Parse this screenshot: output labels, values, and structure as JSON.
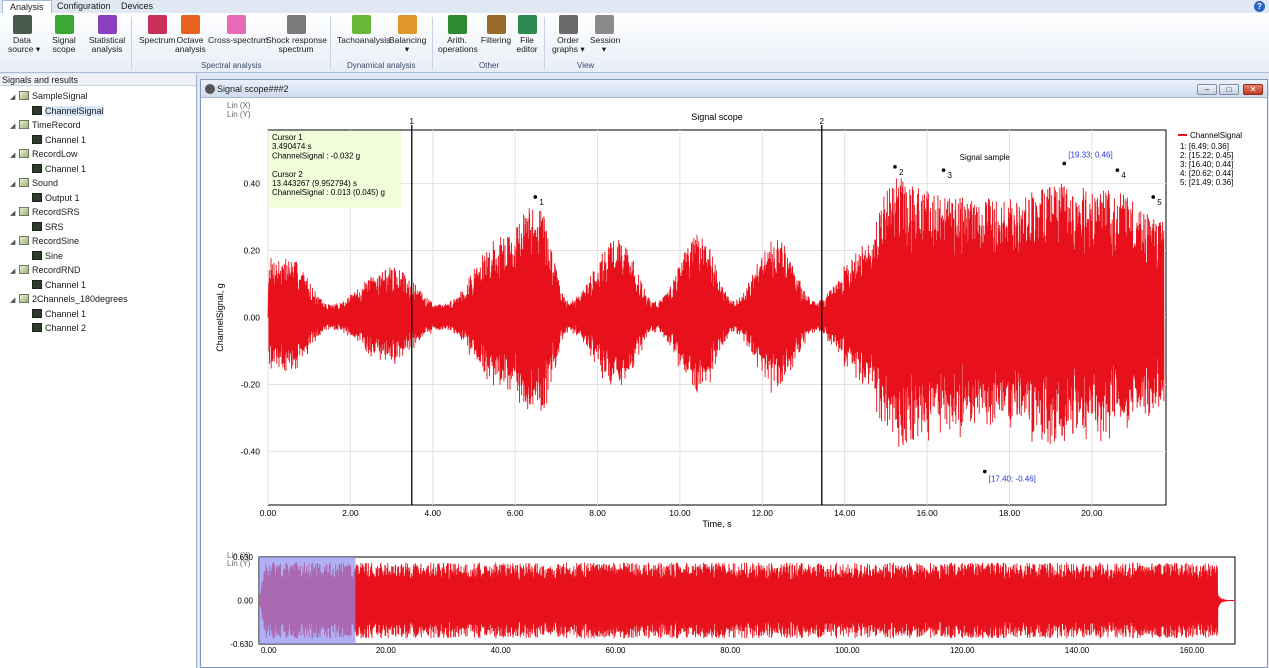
{
  "tabs": [
    {
      "label": "Analysis",
      "active": true
    },
    {
      "label": "Configuration",
      "active": false
    },
    {
      "label": "Devices",
      "active": false
    }
  ],
  "help_glyph": "?",
  "ribbon": {
    "buttons": [
      {
        "id": "data-source",
        "label1": "Data",
        "label2": "source ▾",
        "icon": "database-icon",
        "color": "#4a5a4a"
      },
      {
        "id": "signal-scope",
        "label1": "Signal",
        "label2": "scope",
        "icon": "oscilloscope-icon",
        "color": "#3aa832"
      },
      {
        "id": "statistical-analysis",
        "label1": "Statistical",
        "label2": "analysis",
        "icon": "statistics-icon",
        "color": "#8a3ec0"
      },
      {
        "id": "spectrum",
        "label1": "Spectrum",
        "label2": "",
        "icon": "spectrum-icon",
        "color": "#c8305a"
      },
      {
        "id": "octave-analysis",
        "label1": "Octave",
        "label2": "analysis",
        "icon": "octave-icon",
        "color": "#e8641e"
      },
      {
        "id": "cross-spectrum",
        "label1": "Cross-spectrum",
        "label2": "",
        "icon": "cross-spectrum-icon",
        "color": "#e86ab4"
      },
      {
        "id": "shock-response-spectrum",
        "label1": "Shock response",
        "label2": "spectrum",
        "icon": "shock-icon",
        "color": "#7a7a7a"
      },
      {
        "id": "tachoanalysis",
        "label1": "Tachoanalysis",
        "label2": "",
        "icon": "tacho-icon",
        "color": "#6ab83a"
      },
      {
        "id": "balancing",
        "label1": "Balancing",
        "label2": "▾",
        "icon": "balancing-icon",
        "color": "#e0962a"
      },
      {
        "id": "arith-operations",
        "label1": "Arith.",
        "label2": "operations",
        "icon": "plus-icon",
        "color": "#2e8a2e"
      },
      {
        "id": "filtering",
        "label1": "Filtering",
        "label2": "",
        "icon": "filter-icon",
        "color": "#9a6a2a"
      },
      {
        "id": "file-editor",
        "label1": "File",
        "label2": "editor",
        "icon": "pencil-icon",
        "color": "#2e8a4e"
      },
      {
        "id": "order-graphs",
        "label1": "Order",
        "label2": "graphs ▾",
        "icon": "order-graphs-icon",
        "color": "#6a6a6a"
      },
      {
        "id": "session",
        "label1": "Session",
        "label2": "▾",
        "icon": "session-icon",
        "color": "#8a8a8a"
      }
    ],
    "groups": {
      "spectral": "Spectral analysis",
      "dynamical": "Dynamical analysis",
      "other": "Other",
      "view": "View"
    }
  },
  "panel": {
    "title": "Signals and results",
    "items": [
      {
        "label": "SampleSignal",
        "level": 0
      },
      {
        "label": "ChannelSignal",
        "level": 1,
        "selected": true
      },
      {
        "label": "TimeRecord",
        "level": 0
      },
      {
        "label": "Channel 1",
        "level": 1
      },
      {
        "label": "RecordLow",
        "level": 0
      },
      {
        "label": "Channel 1",
        "level": 1
      },
      {
        "label": "Sound",
        "level": 0
      },
      {
        "label": "Output 1",
        "level": 1
      },
      {
        "label": "RecordSRS",
        "level": 0
      },
      {
        "label": "SRS",
        "level": 1
      },
      {
        "label": "RecordSine",
        "level": 0
      },
      {
        "label": "Sine",
        "level": 1
      },
      {
        "label": "RecordRND",
        "level": 0
      },
      {
        "label": "Channel 1",
        "level": 1
      },
      {
        "label": "2Channels_180degrees",
        "level": 0
      },
      {
        "label": "Channel 1",
        "level": 1
      },
      {
        "label": "Channel 2",
        "level": 1
      }
    ]
  },
  "window": {
    "title": "Signal scope###2",
    "min": "–",
    "max": "□",
    "close": "✕"
  },
  "scale_labels": {
    "x": "Lin (X)",
    "y": "Lin (Y)"
  },
  "chart_data": [
    {
      "type": "line",
      "title": "Signal scope",
      "xlabel": "Time, s",
      "ylabel": "ChannelSignal, g",
      "xlim": [
        0,
        21.8
      ],
      "ylim": [
        -0.56,
        0.56
      ],
      "x_ticks": [
        "0.00",
        "2.00",
        "4.00",
        "6.00",
        "8.00",
        "10.00",
        "12.00",
        "14.00",
        "16.00",
        "18.00",
        "20.00"
      ],
      "y_ticks": [
        "0.40",
        "0.20",
        "0.00",
        "-0.20",
        "-0.40"
      ],
      "series": [
        {
          "name": "ChannelSignal",
          "color": "#e8101a"
        }
      ],
      "envelope": [
        {
          "x": 0.5,
          "a": 0.18
        },
        {
          "x": 1.5,
          "a": 0.04
        },
        {
          "x": 3.0,
          "a": 0.15
        },
        {
          "x": 4.2,
          "a": 0.04
        },
        {
          "x": 5.8,
          "a": 0.25
        },
        {
          "x": 6.5,
          "a": 0.35
        },
        {
          "x": 7.3,
          "a": 0.05
        },
        {
          "x": 8.5,
          "a": 0.24
        },
        {
          "x": 9.4,
          "a": 0.05
        },
        {
          "x": 10.5,
          "a": 0.25
        },
        {
          "x": 11.3,
          "a": 0.05
        },
        {
          "x": 12.3,
          "a": 0.24
        },
        {
          "x": 13.3,
          "a": 0.05
        },
        {
          "x": 14.5,
          "a": 0.22
        },
        {
          "x": 15.2,
          "a": 0.42
        },
        {
          "x": 16.0,
          "a": 0.38
        },
        {
          "x": 17.0,
          "a": 0.36
        },
        {
          "x": 18.0,
          "a": 0.36
        },
        {
          "x": 19.3,
          "a": 0.4
        },
        {
          "x": 20.5,
          "a": 0.38
        },
        {
          "x": 21.6,
          "a": 0.3
        }
      ],
      "cursors": [
        {
          "label": "1",
          "x": 3.490474
        },
        {
          "label": "2",
          "x": 13.443267
        }
      ],
      "cursor_box": [
        "Cursor 1",
        "3.490474 s",
        "ChannelSignal : -0.032 g",
        "",
        "Cursor 2",
        "13.443267 (9.952794) s",
        "ChannelSignal : 0.013 (0.045) g"
      ],
      "peaks": [
        {
          "label": "1",
          "x": 6.49,
          "y": 0.36
        },
        {
          "label": "2",
          "x": 15.22,
          "y": 0.45
        },
        {
          "label": "3",
          "x": 16.4,
          "y": 0.44
        },
        {
          "label": "4",
          "x": 20.62,
          "y": 0.44
        },
        {
          "label": "5",
          "x": 21.49,
          "y": 0.36
        }
      ],
      "annotations": [
        {
          "text": "[19.33; 0.46]",
          "x": 19.33,
          "y": 0.46
        },
        {
          "text": "[17.40; -0.46]",
          "x": 17.4,
          "y": -0.46
        }
      ],
      "sample_label": "Signal sample",
      "legend_title": "ChannelSignal",
      "legend_entries": [
        "1: [6.49; 0.36]",
        "2: [15.22; 0.45]",
        "3: [16.40; 0.44]",
        "4: [20.62; 0.44]",
        "5: [21.49; 0.36]"
      ],
      "legend_position": "right"
    },
    {
      "type": "area",
      "xlim": [
        0,
        170
      ],
      "ylim": [
        -0.63,
        0.63
      ],
      "x_ticks": [
        "0.00",
        "20.00",
        "40.00",
        "60.00",
        "80.00",
        "100.00",
        "120.00",
        "140.00",
        "160.00"
      ],
      "y_ticks": [
        "0.630",
        "0.00",
        "-0.630"
      ],
      "selection": [
        0,
        16.8
      ],
      "signal_end": 167,
      "amplitude": 0.55,
      "selection_color": "#8f8ff0"
    }
  ]
}
